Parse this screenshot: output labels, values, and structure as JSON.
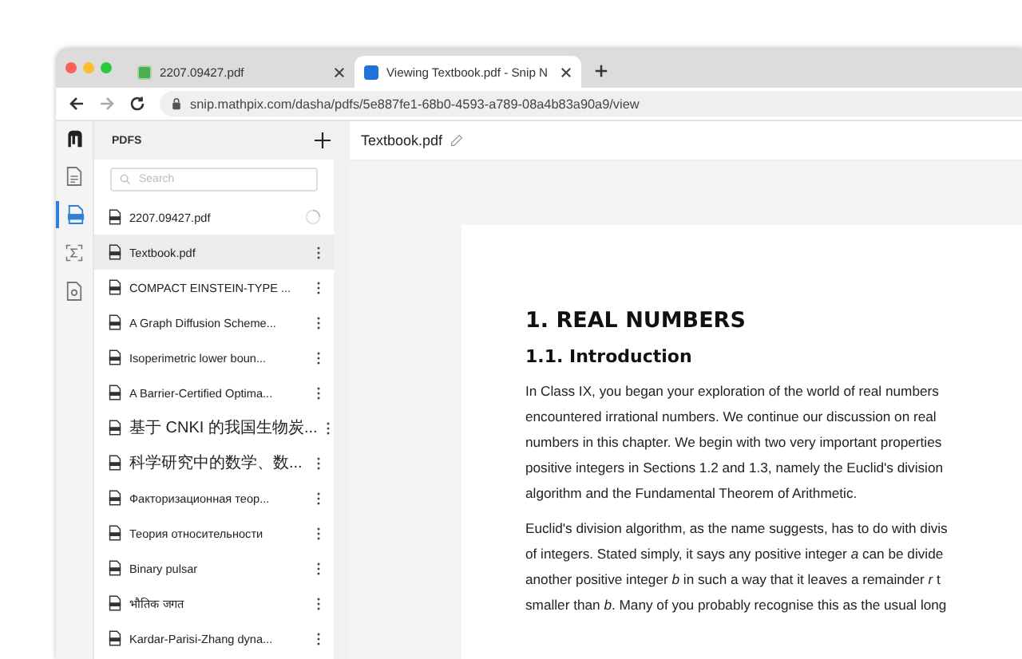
{
  "browser": {
    "tabs": [
      {
        "title": "2207.09427.pdf",
        "selected": false
      },
      {
        "title": "Viewing Textbook.pdf - Snip N",
        "selected": true
      }
    ],
    "url": "snip.mathpix.com/dasha/pdfs/5e887fe1-68b0-4593-a789-08a4b83a90a9/view"
  },
  "rail": [
    {
      "kind": "document",
      "selected": false
    },
    {
      "kind": "pdf",
      "selected": true
    },
    {
      "kind": "formula",
      "selected": false
    },
    {
      "kind": "search-doc",
      "selected": false
    }
  ],
  "sidebar": {
    "title": "PDFS",
    "search": {
      "placeholder": "Search"
    },
    "items": [
      {
        "title": "2207.09427.pdf",
        "kind": "loading",
        "selected": false
      },
      {
        "title": "Textbook.pdf",
        "kind": "menu",
        "selected": true
      },
      {
        "title": "COMPACT EINSTEIN-TYPE ...",
        "kind": "menu",
        "selected": false
      },
      {
        "title": "A Graph Diffusion Scheme...",
        "kind": "menu",
        "selected": false
      },
      {
        "title": "Isoperimetric lower boun...",
        "kind": "menu",
        "selected": false
      },
      {
        "title": "A Barrier-Certified Optima...",
        "kind": "menu",
        "selected": false
      },
      {
        "title": "基于 CNKI 的我国生物炭...",
        "kind": "menu",
        "selected": false
      },
      {
        "title": "科学研究中的数学、数...",
        "kind": "menu",
        "selected": false
      },
      {
        "title": "Факторизационная теор...",
        "kind": "menu",
        "selected": false
      },
      {
        "title": "Теория относительности",
        "kind": "menu",
        "selected": false
      },
      {
        "title": "Binary pulsar",
        "kind": "menu",
        "selected": false
      },
      {
        "title": "भौतिक जगत",
        "kind": "menu",
        "selected": false
      },
      {
        "title": "Kardar-Parisi-Zhang dyna...",
        "kind": "menu",
        "selected": false
      }
    ]
  },
  "document": {
    "filename": "Textbook.pdf",
    "heading": "1. REAL NUMBERS",
    "subheading": "1.1. Introduction",
    "paragraphs": [
      [
        "In Class IX, you began your exploration of the world of real numbers",
        "encountered irrational numbers. We continue our discussion on real",
        "numbers in this chapter. We begin with two very important properties",
        "positive integers in Sections 1.2 and 1.3, namely the Euclid's division",
        "algorithm and the Fundamental Theorem of Arithmetic."
      ],
      [
        "Euclid's division algorithm, as the name suggests, has to do with divis",
        "of integers. Stated simply, it says any positive integer *a* can be divide",
        "another positive integer *b* in such a way that it leaves a remainder *r* t",
        "smaller than *b*. Many of you probably recognise this as the usual long"
      ]
    ]
  }
}
